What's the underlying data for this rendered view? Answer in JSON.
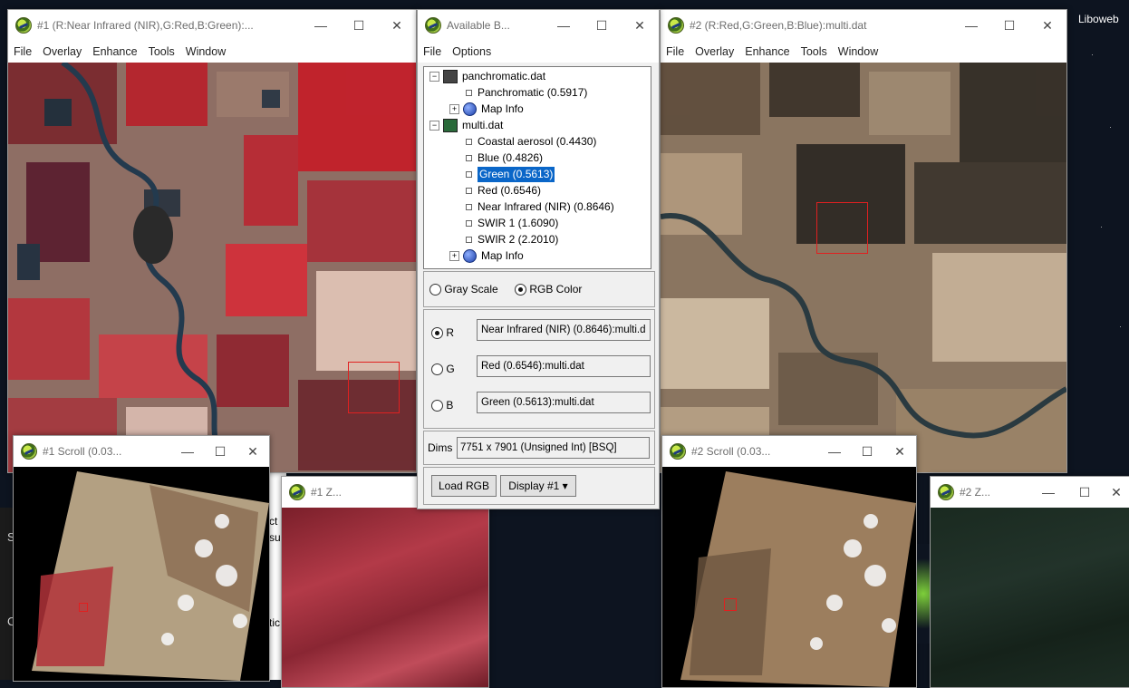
{
  "desktop": {
    "label": "Liboweb"
  },
  "display1": {
    "title": "#1 (R:Near Infrared (NIR),G:Red,B:Green):...",
    "menu": [
      "File",
      "Overlay",
      "Enhance",
      "Tools",
      "Window"
    ]
  },
  "display2": {
    "title": "#2 (R:Red,G:Green,B:Blue):multi.dat",
    "menu": [
      "File",
      "Overlay",
      "Enhance",
      "Tools",
      "Window"
    ]
  },
  "scroll1": {
    "title": "#1 Scroll (0.03..."
  },
  "scroll2": {
    "title": "#2 Scroll (0.03..."
  },
  "zoom1": {
    "title": "#1 Z..."
  },
  "zoom2": {
    "title": "#2 Z..."
  },
  "bandlist": {
    "title": "Available B...",
    "menu": [
      "File",
      "Options"
    ],
    "tree": {
      "file1": "panchromatic.dat",
      "file1_bands": [
        "Panchromatic (0.5917)"
      ],
      "file1_mapinfo": "Map Info",
      "file2": "multi.dat",
      "file2_bands": [
        "Coastal aerosol (0.4430)",
        "Blue (0.4826)",
        "Green (0.5613)",
        "Red (0.6546)",
        "Near Infrared (NIR) (0.8646)",
        "SWIR 1 (1.6090)",
        "SWIR 2 (2.2010)"
      ],
      "file2_mapinfo": "Map Info",
      "selected_band": "Green (0.5613)"
    },
    "mode": {
      "gray_label": "Gray Scale",
      "rgb_label": "RGB Color",
      "selected": "RGB Color"
    },
    "channels": {
      "r_label": "R",
      "r_value": "Near Infrared (NIR) (0.8646):multi.d",
      "g_label": "G",
      "g_value": "Red (0.6546):multi.dat",
      "b_label": "B",
      "b_value": "Green (0.5613):multi.dat",
      "selected": "R"
    },
    "dims": {
      "label": "Dims",
      "value": "7751 x 7901 (Unsigned Int) [BSQ]"
    },
    "load_button": "Load RGB",
    "display_button": "Display #1"
  },
  "window_controls": {
    "minimize": "—",
    "maximize": "☐",
    "close": "✕"
  },
  "background_fragments": [
    "S",
    "C",
    "ct",
    "su",
    "tic"
  ]
}
